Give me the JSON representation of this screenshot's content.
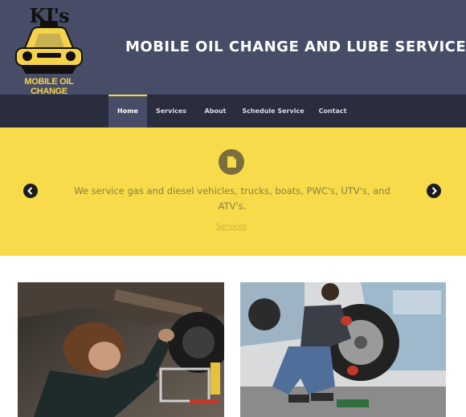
{
  "logo": {
    "title": "KJ's",
    "subtitle": "MOBILE OIL CHANGE"
  },
  "site_title": "MOBILE OIL CHANGE AND LUBE SERVICES",
  "nav": {
    "items": [
      {
        "label": "Home",
        "active": true
      },
      {
        "label": "Services"
      },
      {
        "label": "About"
      },
      {
        "label": "Schedule Service"
      },
      {
        "label": "Contact"
      }
    ]
  },
  "hero": {
    "icon": "document-icon",
    "text": "We service gas and diesel vehicles, trucks, boats, PWC's, UTV's, and ATV's.",
    "link": "Services"
  },
  "colors": {
    "header": "#474d66",
    "nav": "#2a2d3d",
    "accent": "#f7db4b"
  },
  "photos": [
    {
      "icon": "mechanic-under-car-photo"
    },
    {
      "icon": "mechanic-changing-tire-photo"
    }
  ]
}
